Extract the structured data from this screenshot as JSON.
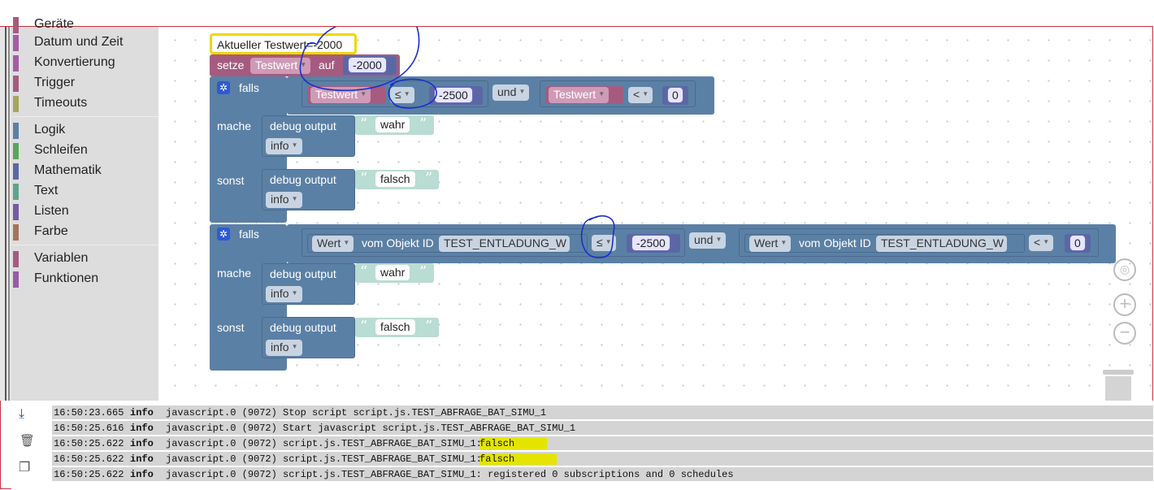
{
  "toolbox": {
    "items": [
      {
        "label": "Geräte",
        "color": "#a55b80"
      },
      {
        "label": "Datum und Zeit",
        "color": "#a55ba5"
      },
      {
        "label": "Konvertierung",
        "color": "#a55ba5"
      },
      {
        "label": "Trigger",
        "color": "#a55b80"
      },
      {
        "label": "Timeouts",
        "color": "#a5a55b"
      },
      {
        "label": "Logik",
        "color": "#5b80a5"
      },
      {
        "label": "Schleifen",
        "color": "#5ba55b"
      },
      {
        "label": "Mathematik",
        "color": "#5b67a5"
      },
      {
        "label": "Text",
        "color": "#5ba58c"
      },
      {
        "label": "Listen",
        "color": "#745ba5"
      },
      {
        "label": "Farbe",
        "color": "#a5745b"
      },
      {
        "label": "Variablen",
        "color": "#a55b80"
      },
      {
        "label": "Funktionen",
        "color": "#995ba5"
      }
    ]
  },
  "blocks": {
    "comment": "Aktueller Testwert=-2000",
    "setze": {
      "label": "setze",
      "var": "Testwert",
      "auf": "auf",
      "value": "-2000"
    },
    "if1": {
      "falls": "falls",
      "left_var": "Testwert",
      "op1": "≤",
      "num1": "-2500",
      "und": "und",
      "right_var": "Testwert",
      "op2": "<",
      "num2": "0",
      "mache": "mache",
      "sonst": "sonst",
      "debug_label": "debug output",
      "level": "info",
      "true_text": "wahr",
      "false_text": "falsch"
    },
    "if2": {
      "falls": "falls",
      "wert": "Wert",
      "vom": "vom Objekt ID",
      "obj_id": "TEST_ENTLADUNG_W",
      "op1": "≤",
      "num1": "-2500",
      "und": "und",
      "op2": "<",
      "num2": "0",
      "mache": "mache",
      "sonst": "sonst",
      "debug_label": "debug output",
      "level": "info",
      "true_text": "wahr",
      "false_text": "falsch"
    }
  },
  "log": {
    "rows": [
      {
        "time": "16:50:23.665",
        "level": "info",
        "msg": "javascript.0 (9072) Stop script script.js.TEST_ABFRAGE_BAT_SIMU_1",
        "hl": ""
      },
      {
        "time": "16:50:25.616",
        "level": "info",
        "msg": "javascript.0 (9072) Start javascript script.js.TEST_ABFRAGE_BAT_SIMU_1",
        "hl": ""
      },
      {
        "time": "16:50:25.622",
        "level": "info",
        "msg": "javascript.0 (9072) script.js.TEST_ABFRAGE_BAT_SIMU_1:",
        "hl": " falsch"
      },
      {
        "time": "16:50:25.622",
        "level": "info",
        "msg": "javascript.0 (9072) script.js.TEST_ABFRAGE_BAT_SIMU_1:",
        "hl": " falsch"
      },
      {
        "time": "16:50:25.622",
        "level": "info",
        "msg": "javascript.0 (9072) script.js.TEST_ABFRAGE_BAT_SIMU_1: registered 0 subscriptions and 0 schedules",
        "hl": ""
      }
    ]
  },
  "colors": {
    "logic": "#5b80a5",
    "variable": "#a55b80",
    "comment_border": "#f2d600",
    "highlight": "#e4e400"
  }
}
